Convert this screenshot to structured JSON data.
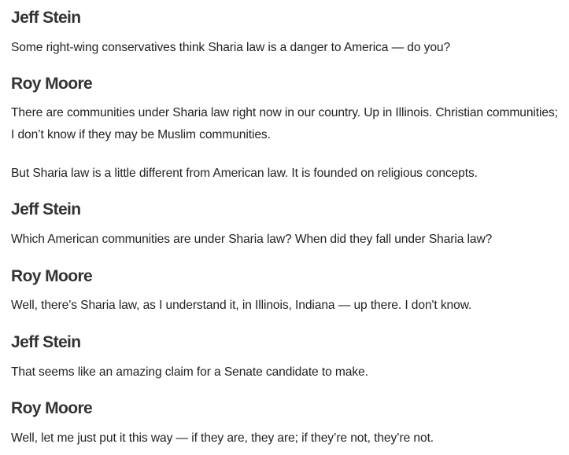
{
  "transcript": [
    {
      "speaker": "Jeff Stein",
      "paragraphs": [
        "Some right-wing conservatives think Sharia law is a danger to America — do you?"
      ]
    },
    {
      "speaker": "Roy Moore",
      "paragraphs": [
        "There are communities under Sharia law right now in our country. Up in Illinois. Christian communities; I don’t know if they may be Muslim communities.",
        "But Sharia law is a little different from American law. It is founded on religious concepts."
      ]
    },
    {
      "speaker": "Jeff Stein",
      "paragraphs": [
        "Which American communities are under Sharia law? When did they fall under Sharia law?"
      ]
    },
    {
      "speaker": "Roy Moore",
      "paragraphs": [
        "Well, there’s Sharia law, as I understand it, in Illinois, Indiana — up there. I don't know."
      ]
    },
    {
      "speaker": "Jeff Stein",
      "paragraphs": [
        "That seems like an amazing claim for a Senate candidate to make."
      ]
    },
    {
      "speaker": "Roy Moore",
      "paragraphs": [
        "Well, let me just put it this way — if they are, they are; if they’re not, they’re not."
      ]
    }
  ]
}
